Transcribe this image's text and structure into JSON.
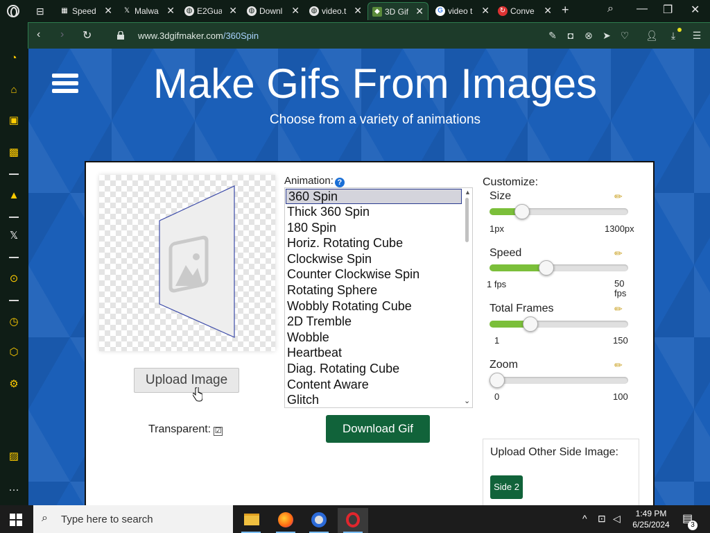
{
  "browser": {
    "tabs": [
      {
        "label": "Speed",
        "favicon": "grid-icon"
      },
      {
        "label": "Malwa",
        "favicon": "x-icon"
      },
      {
        "label": "E2Gua",
        "favicon": "globe-icon"
      },
      {
        "label": "Downl",
        "favicon": "globe-icon"
      },
      {
        "label": "video.t",
        "favicon": "globe-icon"
      },
      {
        "label": "3D Gif",
        "favicon": "3dgifmaker-icon",
        "active": true
      },
      {
        "label": "video t",
        "favicon": "google-icon"
      },
      {
        "label": "Conve",
        "favicon": "converter-icon"
      }
    ],
    "url_host": "www.3dgifmaker.com",
    "url_path": "/360Spin"
  },
  "page": {
    "title": "Make Gifs From Images",
    "subtitle": "Choose from a variety of animations",
    "upload_label": "Upload Image",
    "transparent_label": "Transparent:",
    "transparent_checked": "☑",
    "animation_label": "Animation:",
    "help_glyph": "?",
    "animations": [
      "360 Spin",
      "Thick 360 Spin",
      "180 Spin",
      "Horiz. Rotating Cube",
      "Clockwise Spin",
      "Counter Clockwise Spin",
      "Rotating Sphere",
      "Wobbly Rotating Cube",
      "2D Tremble",
      "Wobble",
      "Heartbeat",
      "Diag. Rotating Cube",
      "Content Aware",
      "Glitch"
    ],
    "selected_animation": "360 Spin",
    "download_label": "Download Gif",
    "customize_label": "Customize:",
    "sliders": {
      "size": {
        "label": "Size",
        "min_label": "1px",
        "max_label": "1300px",
        "level": 0.2
      },
      "speed": {
        "label": "Speed",
        "min_label": "1 fps",
        "max_label": "50\nfps",
        "level": 0.4
      },
      "frames": {
        "label": "Total Frames",
        "min_label": "1",
        "max_label": "150",
        "level": 0.27
      },
      "zoom": {
        "label": "Zoom",
        "min_label": "0",
        "max_label": "100",
        "level": 0.0
      }
    },
    "side_image_label": "Upload Other Side Image:",
    "side2_label": "Side 2"
  },
  "taskbar": {
    "search_placeholder": "Type here to search",
    "time": "1:49 PM",
    "date": "6/25/2024",
    "notifications": "3"
  },
  "colors": {
    "accent_green": "#11633a",
    "slider_fill": "#7bbf3a",
    "page_blue": "#1b5fb8",
    "browser_dark": "#0f1d16"
  }
}
